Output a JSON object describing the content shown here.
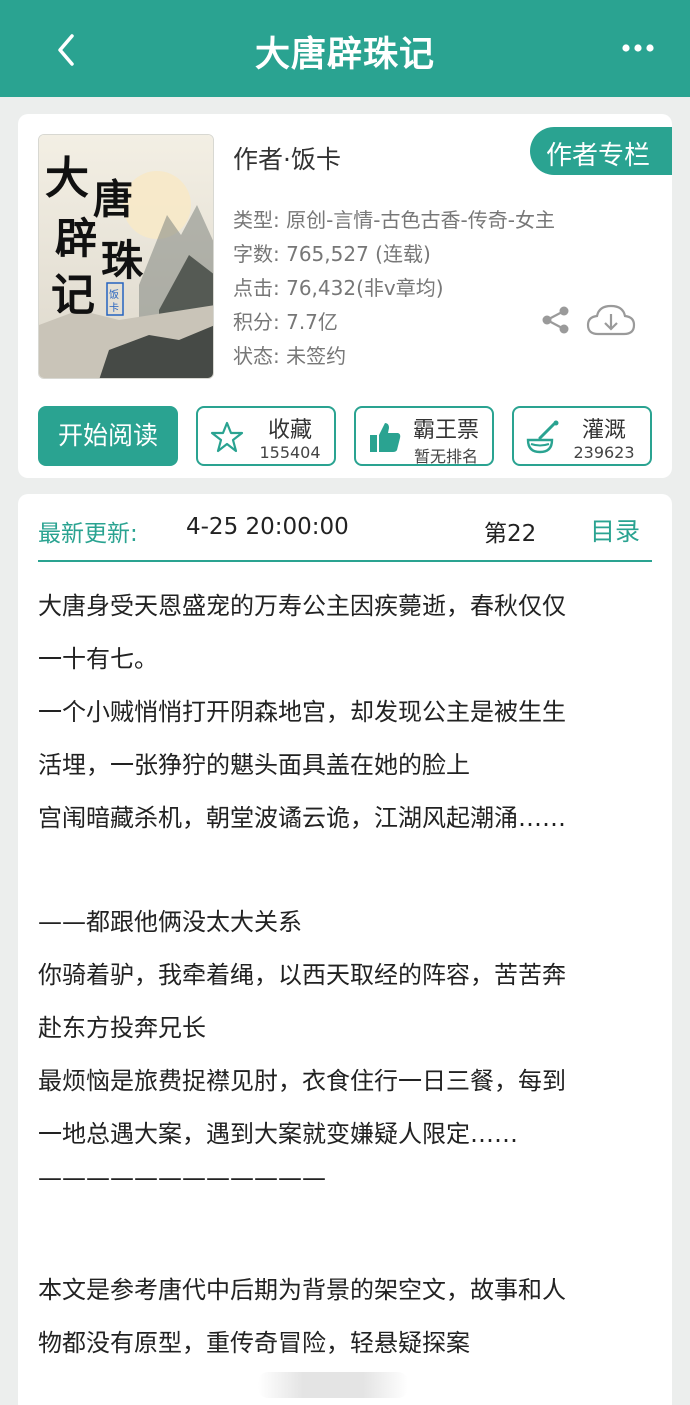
{
  "header": {
    "title": "大唐辟珠记"
  },
  "book": {
    "cover_title": "大唐辟珠记",
    "cover_seal": "饭卡",
    "author": "作者·饭卡",
    "author_column_label": "作者专栏",
    "type": "类型: 原创-言情-古色古香-传奇-女主",
    "word_count": "字数: 765,527 (连载)",
    "clicks": "点击: 76,432(非v章均)",
    "score": "积分: 7.7亿",
    "status": "状态: 未签约"
  },
  "actions": {
    "read_label": "开始阅读",
    "collect_label": "收藏",
    "collect_count": "155404",
    "vote_label": "霸王票",
    "vote_sub": "暂无排名",
    "nutrient_label": "灌溉",
    "nutrient_count": "239623"
  },
  "update": {
    "label": "最新更新:",
    "time": "4-25 20:00:00",
    "chapter": "第22",
    "toc_label": "目录"
  },
  "description": [
    "大唐身受天恩盛宠的万寿公主因疾薨逝，春秋仅仅",
    "一十有七。",
    "一个小贼悄悄打开阴森地宫，却发现公主是被生生",
    "活埋，一张狰狞的魌头面具盖在她的脸上",
    "宫闱暗藏杀机，朝堂波谲云诡，江湖风起潮涌……",
    "",
    "——都跟他俩没太大关系",
    "你骑着驴，我牵着绳，以西天取经的阵容，苦苦奔",
    "赴东方投奔兄长",
    "最烦恼是旅费捉襟见肘，衣食住行一日三餐，每到",
    "一地总遇大案，遇到大案就变嫌疑人限定……",
    "————————————",
    "",
    "本文是参考唐代中后期为背景的架空文，故事和人",
    "物都没有原型，重传奇冒险，轻悬疑探案"
  ],
  "colors": {
    "primary": "#2aa391",
    "background": "#eceeed"
  },
  "icons": [
    "back-arrow-icon",
    "more-dots-icon",
    "share-icon",
    "download-cloud-icon",
    "star-icon",
    "thumbs-up-icon",
    "watering-icon"
  ]
}
